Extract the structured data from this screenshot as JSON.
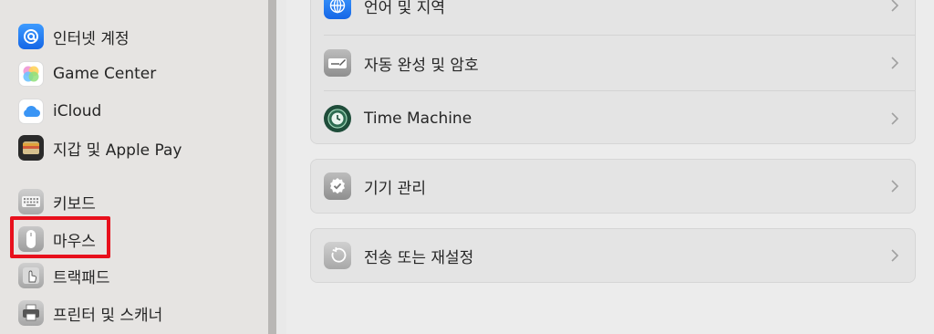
{
  "sidebar": {
    "items": [
      {
        "label": "인터넷 계정",
        "icon": "at-sign-icon"
      },
      {
        "label": "Game Center",
        "icon": "game-center-icon"
      },
      {
        "label": "iCloud",
        "icon": "cloud-icon"
      },
      {
        "label": "지갑 및 Apple Pay",
        "icon": "wallet-icon"
      },
      {
        "label": "키보드",
        "icon": "keyboard-icon"
      },
      {
        "label": "마우스",
        "icon": "mouse-icon"
      },
      {
        "label": "트랙패드",
        "icon": "trackpad-icon"
      },
      {
        "label": "프린터 및 스캐너",
        "icon": "printer-icon"
      }
    ],
    "highlighted": "마우스",
    "highlight_color": "#e8101c"
  },
  "main": {
    "group1": [
      {
        "label": "언어 및 지역",
        "icon": "globe-icon"
      },
      {
        "label": "자동 완성 및 암호",
        "icon": "autofill-icon"
      },
      {
        "label": "Time Machine",
        "icon": "time-machine-icon"
      }
    ],
    "group2": [
      {
        "label": "기기 관리",
        "icon": "device-management-icon"
      }
    ],
    "group3": [
      {
        "label": "전송 또는 재설정",
        "icon": "reset-icon"
      }
    ]
  },
  "colors": {
    "accent_blue": "#1e7cf0"
  }
}
